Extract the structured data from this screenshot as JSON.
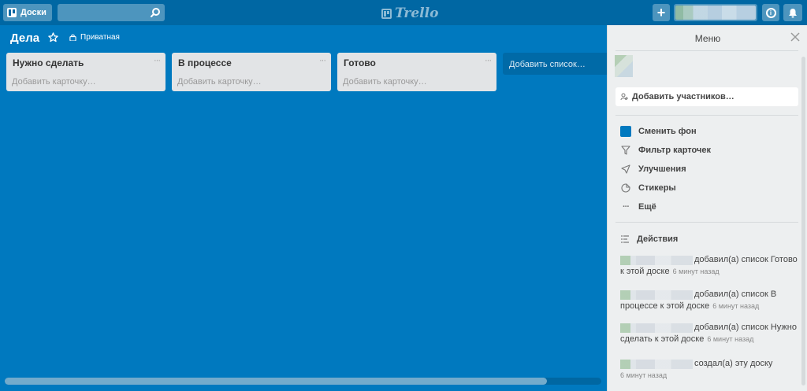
{
  "header": {
    "boards_label": "Доски",
    "search_placeholder": "",
    "logo_text": "Trello",
    "add_label": "+"
  },
  "board": {
    "title": "Дела",
    "privacy": "Приватная"
  },
  "lists": [
    {
      "title": "Нужно сделать",
      "menu": "···",
      "add_card": "Добавить карточку…"
    },
    {
      "title": "В процессе",
      "menu": "···",
      "add_card": "Добавить карточку…"
    },
    {
      "title": "Готово",
      "menu": "···",
      "add_card": "Добавить карточку…"
    }
  ],
  "add_list_label": "Добавить список…",
  "sidebar": {
    "title": "Меню",
    "add_members": "Добавить участников…",
    "items": [
      {
        "label": "Сменить фон",
        "icon": "background-swatch-icon"
      },
      {
        "label": "Фильтр карточек",
        "icon": "filter-icon"
      },
      {
        "label": "Улучшения",
        "icon": "power-up-icon"
      },
      {
        "label": "Стикеры",
        "icon": "sticker-icon"
      },
      {
        "label": "Ещё",
        "icon": "more-icon"
      }
    ],
    "actions_title": "Действия",
    "activities": [
      {
        "line1": "добавил(а) список Готово",
        "line2": "к этой доске",
        "time": "6 минут назад"
      },
      {
        "line1": "добавил(а) список В",
        "line2": "процессе к этой доске",
        "time": "6 минут назад"
      },
      {
        "line1": "добавил(а) список Нужно",
        "line2": "сделать к этой доске",
        "time": "6 минут назад"
      },
      {
        "line1": "создал(а) эту доску",
        "line2": "",
        "time": "6 минут назад"
      }
    ]
  },
  "colors": {
    "board_bg": "#0079bf",
    "header_bg": "#0067a3",
    "list_bg": "#e2e4e6",
    "sidebar_bg": "#edeff0"
  }
}
